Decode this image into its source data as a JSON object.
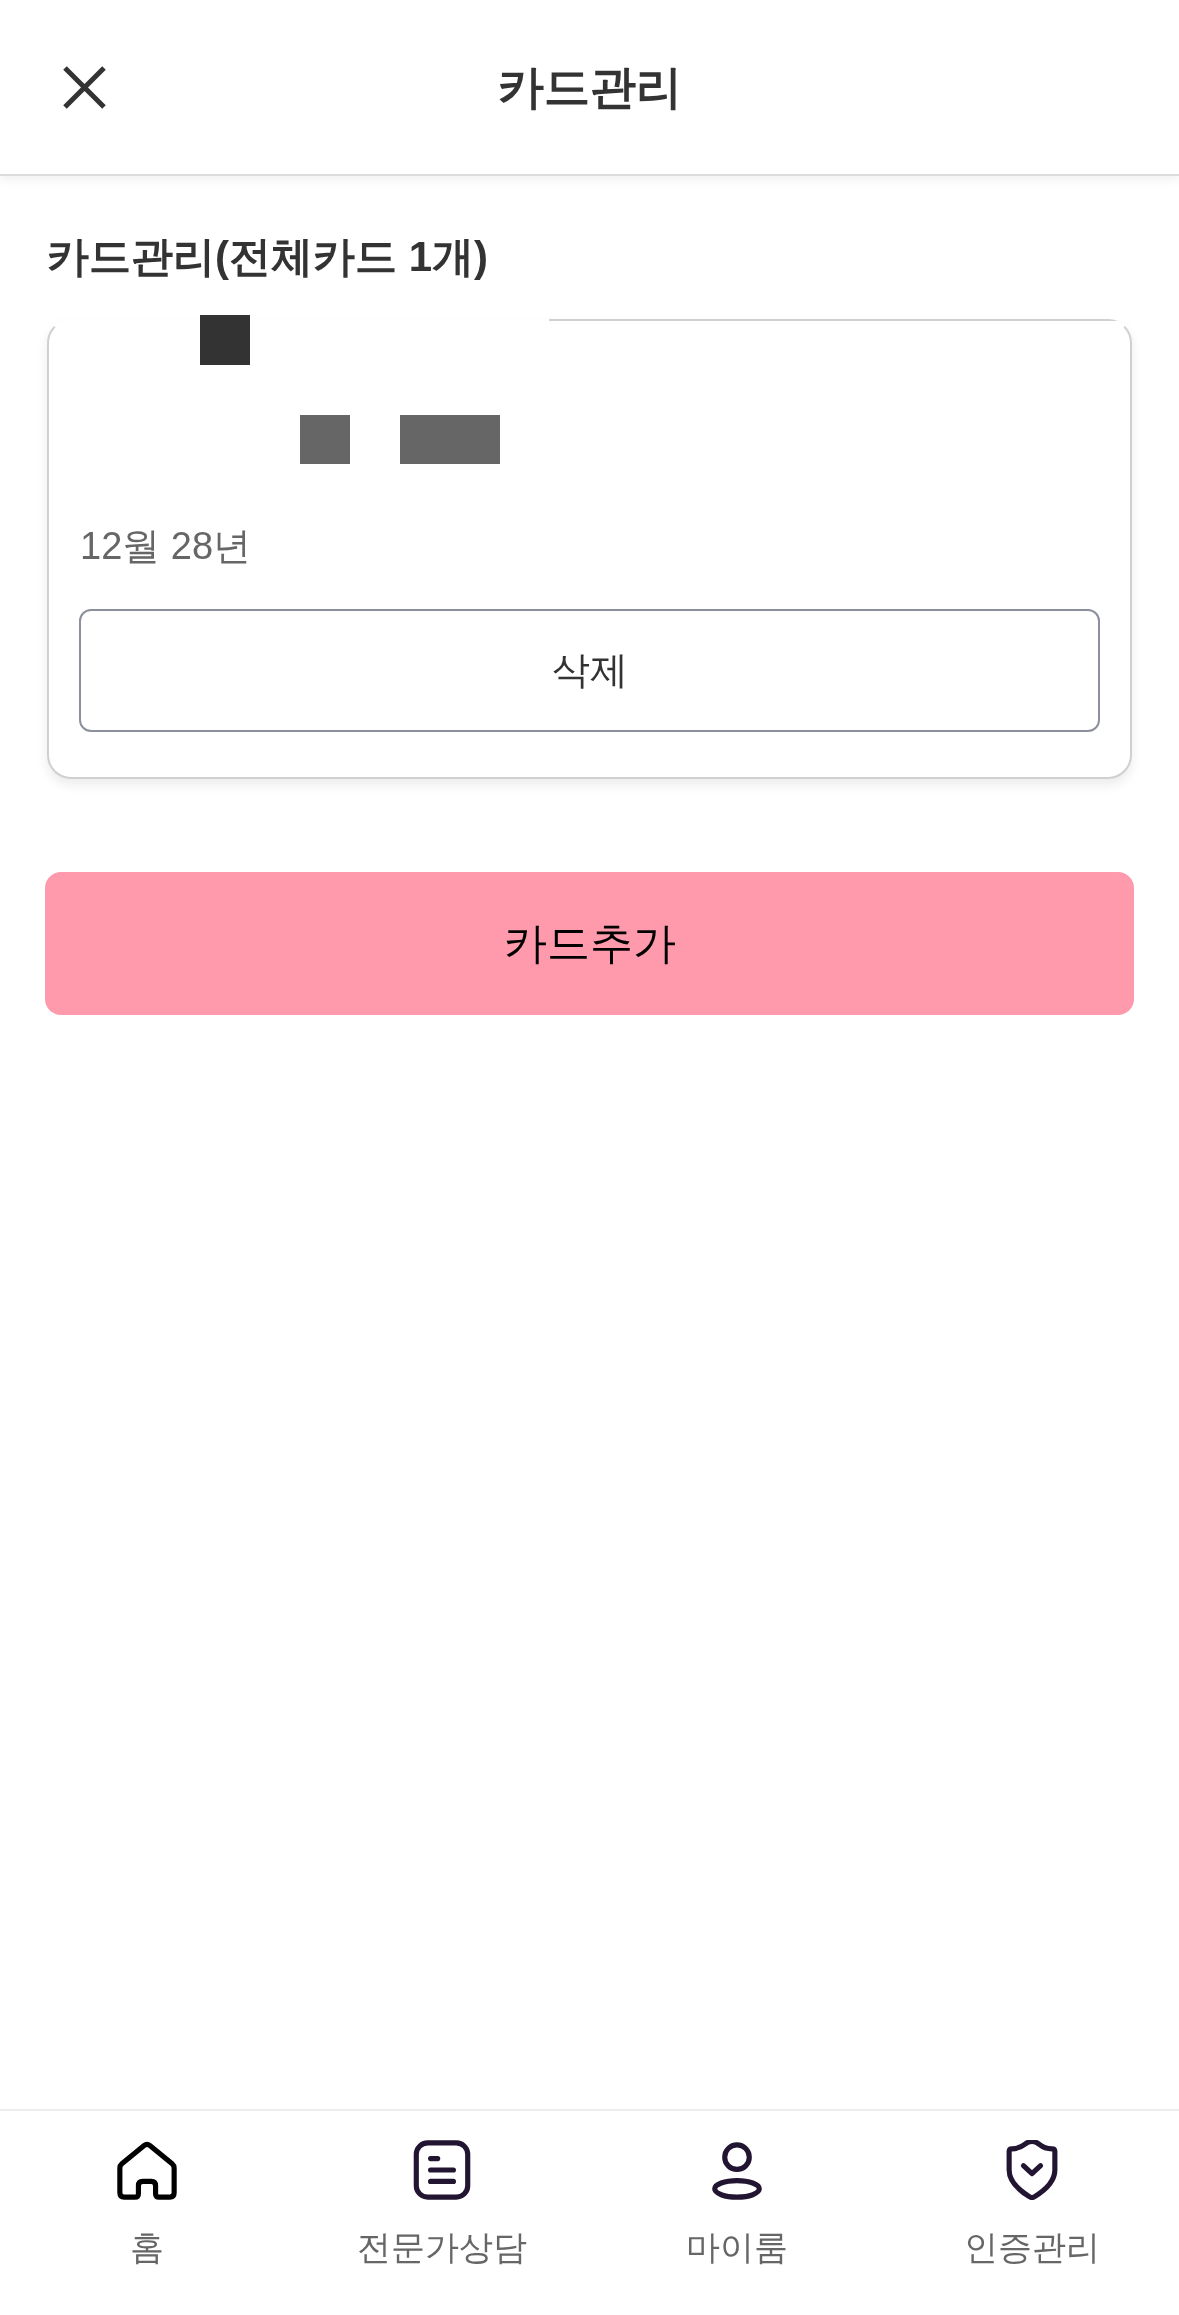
{
  "header": {
    "title": "카드관리"
  },
  "section_title": "카드관리(전체카드 1개)",
  "cards": [
    {
      "expiry": "12월 28년",
      "delete_button": "삭제"
    }
  ],
  "add_button": "카드추가",
  "bottom_nav": [
    {
      "label": "홈"
    },
    {
      "label": "전문가상담"
    },
    {
      "label": "마이룸"
    },
    {
      "label": "인증관리"
    }
  ]
}
